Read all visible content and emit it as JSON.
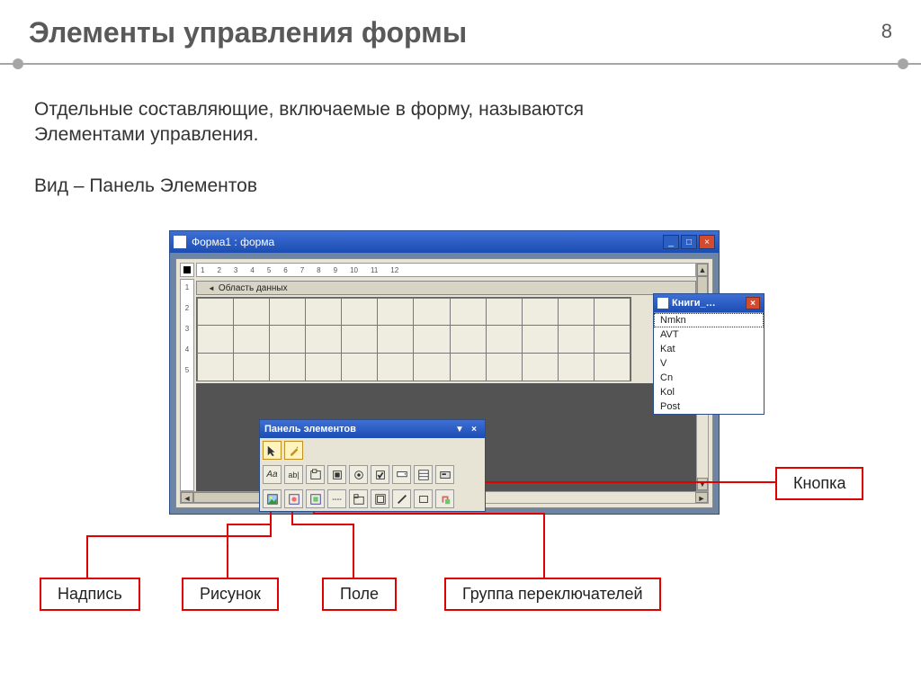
{
  "slide": {
    "title": "Элементы управления формы",
    "page_number": "8",
    "paragraph1_l1": "Отдельные составляющие, включаемые в форму, называются",
    "paragraph1_l2": "Элементами управления.",
    "paragraph2": "Вид – Панель Элементов"
  },
  "form_window": {
    "title": "Форма1 : форма",
    "section_header": "Область данных",
    "ruler_h": [
      "1",
      "2",
      "3",
      "4",
      "5",
      "6",
      "7",
      "8",
      "9",
      "10",
      "11",
      "12"
    ],
    "ruler_v": [
      "1",
      "2",
      "3",
      "4",
      "5"
    ]
  },
  "toolbox": {
    "title": "Панель элементов"
  },
  "fieldlist": {
    "title": "Книги_…",
    "items": [
      "Nmkn",
      "AVT",
      "Kat",
      "V",
      "Cn",
      "Kol",
      "Post"
    ]
  },
  "callouts": {
    "knopka": "Кнопка",
    "nadpis": "Надпись",
    "risunok": "Рисунок",
    "pole": "Поле",
    "gruppa": "Группа переключателей"
  }
}
